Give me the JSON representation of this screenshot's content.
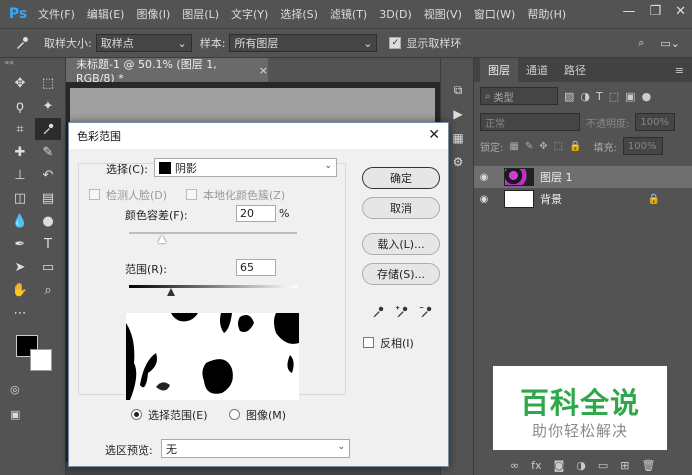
{
  "app": {
    "logo": "Ps",
    "menu": [
      "文件(F)",
      "编辑(E)",
      "图像(I)",
      "图层(L)",
      "文字(Y)",
      "选择(S)",
      "滤镜(T)",
      "3D(D)",
      "视图(V)",
      "窗口(W)",
      "帮助(H)"
    ]
  },
  "options": {
    "sample_size_label": "取样大小:",
    "sample_size_value": "取样点",
    "sample_label": "样本:",
    "sample_value": "所有图层",
    "show_ring_label": "显示取样环"
  },
  "document": {
    "tab_title": "未标题-1 @ 50.1% (图层 1, RGB/8) *"
  },
  "layers": {
    "tabs": [
      "图层",
      "通道",
      "路径"
    ],
    "kind_label": "类型",
    "blend_mode": "正常",
    "opacity_label": "不透明度:",
    "opacity_value": "100%",
    "lock_label": "锁定:",
    "fill_label": "填充:",
    "fill_value": "100%",
    "items": [
      {
        "name": "图层 1"
      },
      {
        "name": "背景"
      }
    ]
  },
  "dialog": {
    "title": "色彩范围",
    "select_label": "选择(C):",
    "select_value": "阴影",
    "detect_faces": "检测人脸(D)",
    "localized": "本地化颜色簇(Z)",
    "fuzziness_label": "颜色容差(F):",
    "fuzziness_value": "20",
    "fuzziness_unit": "%",
    "range_label": "范围(R):",
    "range_value": "65",
    "radio_selection": "选择范围(E)",
    "radio_image": "图像(M)",
    "preview_label": "选区预览:",
    "preview_value": "无",
    "ok": "确定",
    "cancel": "取消",
    "load": "载入(L)...",
    "save": "存储(S)...",
    "invert": "反相(I)"
  },
  "watermark": {
    "title": "百科全说",
    "subtitle": "助你轻松解决"
  },
  "colors": {
    "foreground": "#000000",
    "background": "#ffffff",
    "watermark_green": "#2ea84a"
  }
}
